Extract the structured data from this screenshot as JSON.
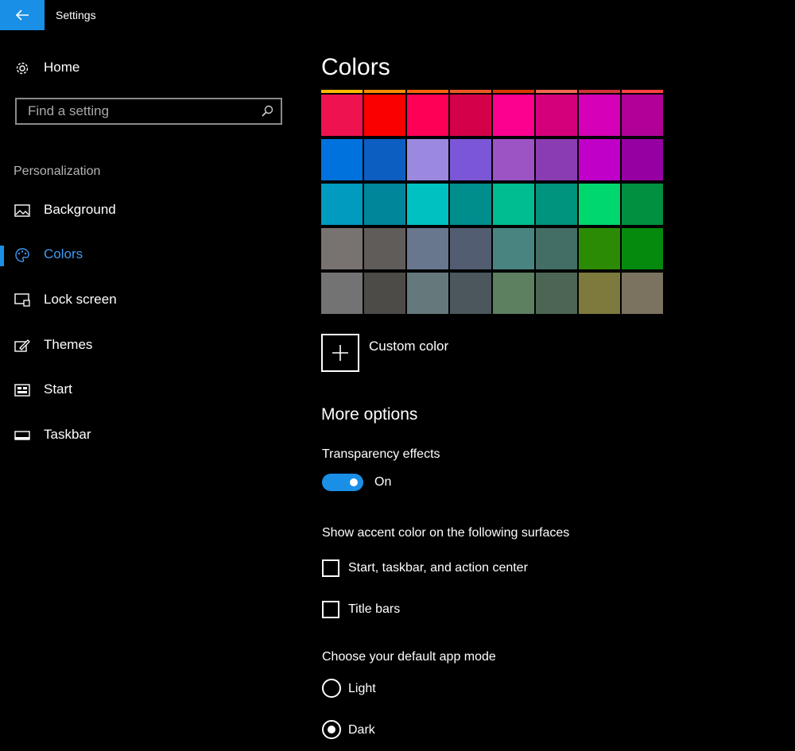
{
  "window": {
    "title": "Settings"
  },
  "sidebar": {
    "home_label": "Home",
    "search": {
      "placeholder": "Find a setting",
      "value": ""
    },
    "section_header": "Personalization",
    "items": [
      {
        "label": "Background",
        "icon": "image-icon"
      },
      {
        "label": "Colors",
        "icon": "palette-icon",
        "active": true
      },
      {
        "label": "Lock screen",
        "icon": "lock-screen-icon"
      },
      {
        "label": "Themes",
        "icon": "themes-icon"
      },
      {
        "label": "Start",
        "icon": "start-icon"
      },
      {
        "label": "Taskbar",
        "icon": "taskbar-icon"
      }
    ]
  },
  "main": {
    "title": "Colors",
    "accent_colors": [
      [
        "#ee1250",
        "#fb0000",
        "#fe0055",
        "#d5004a",
        "#fc0090",
        "#d4007b",
        "#d500b8",
        "#b00098"
      ],
      [
        "#0072dd",
        "#0c5ec0",
        "#9b89e0",
        "#7b56d6",
        "#9c53c4",
        "#8a3cb3",
        "#c000c8",
        "#9600a2"
      ],
      [
        "#009bbf",
        "#00869b",
        "#00c1c1",
        "#008e8d",
        "#00bc91",
        "#00937d",
        "#00d86f",
        "#009040"
      ],
      [
        "#787370",
        "#5f5c5a",
        "#68768e",
        "#525d72",
        "#498480",
        "#426e65",
        "#2b8b05",
        "#058a0e"
      ],
      [
        "#737373",
        "#4d4b48",
        "#65797d",
        "#4b575c",
        "#5c8060",
        "#4d6654",
        "#7e7a3e",
        "#7b7360"
      ]
    ],
    "top_row_colors": [
      "#ffb900",
      "#ff8c00",
      "#f7630c",
      "#ea5a25",
      "#da3b01",
      "#ef6950",
      "#d13438",
      "#ff4343"
    ],
    "custom_color_label": "Custom color",
    "more_options_header": "More options",
    "transparency": {
      "label": "Transparency effects",
      "state": "On"
    },
    "accent_surfaces": {
      "label": "Show accent color on the following surfaces",
      "options": [
        {
          "label": "Start, taskbar, and action center",
          "checked": false
        },
        {
          "label": "Title bars",
          "checked": false
        }
      ]
    },
    "app_mode": {
      "label": "Choose your default app mode",
      "options": [
        {
          "label": "Light",
          "selected": false
        },
        {
          "label": "Dark",
          "selected": true
        }
      ]
    }
  },
  "colors": {
    "accent": "#1a8fe6",
    "active_text": "#3d9bf0",
    "background": "#000000"
  }
}
